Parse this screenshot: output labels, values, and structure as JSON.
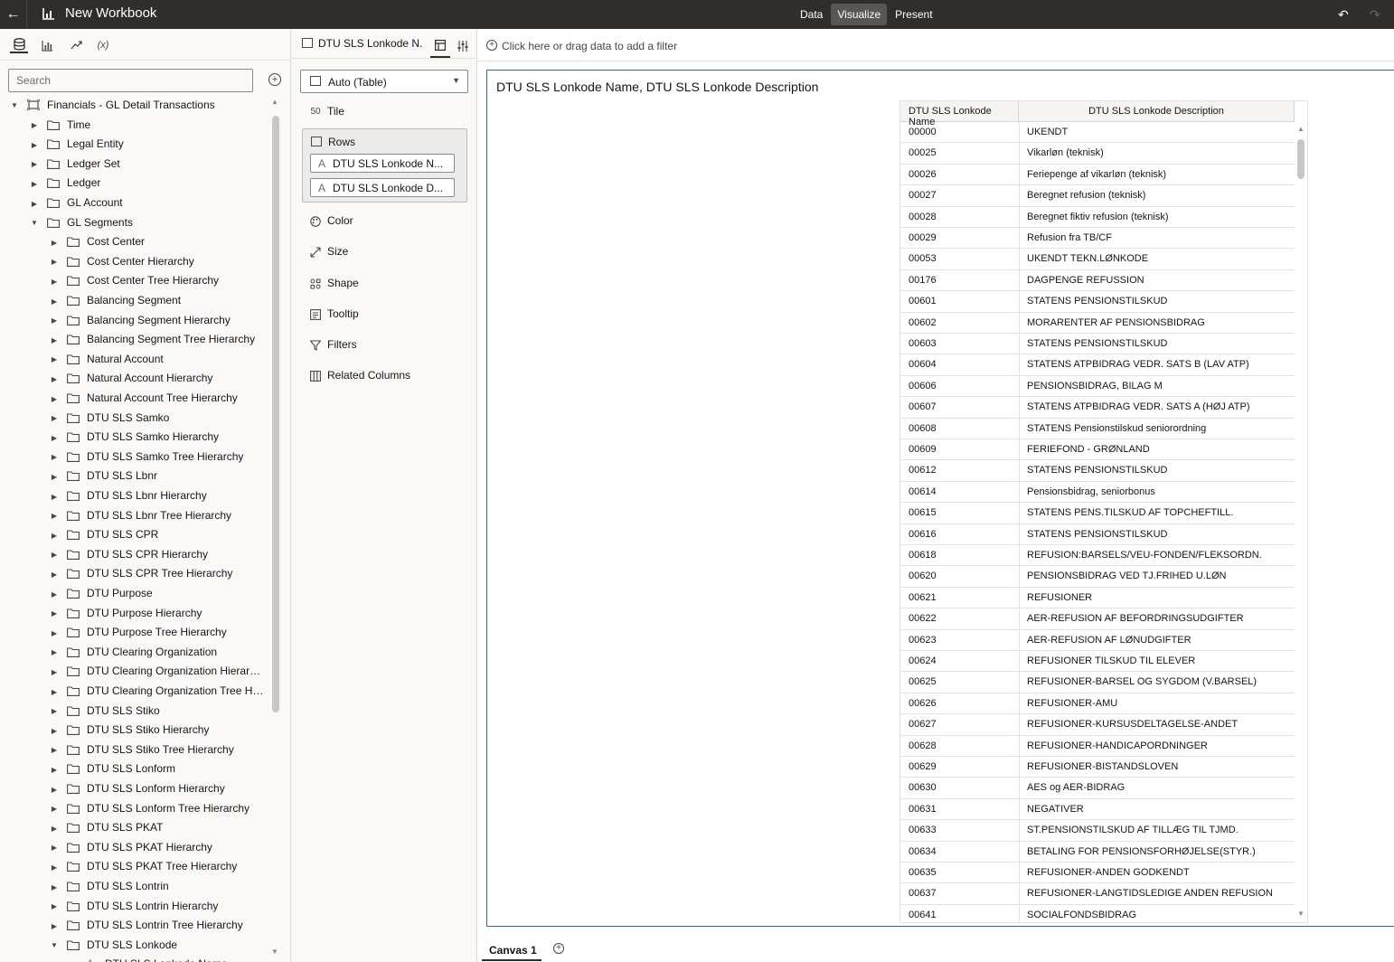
{
  "header": {
    "title": "New Workbook",
    "modes": [
      "Data",
      "Visualize",
      "Present"
    ],
    "active_mode": "Visualize"
  },
  "data_panel": {
    "search_placeholder": "Search",
    "subject_area": "Financials - GL Detail Transactions",
    "folders": [
      "Time",
      "Legal Entity",
      "Ledger Set",
      "Ledger",
      "GL Account",
      "GL Segments"
    ],
    "segments": [
      "Cost Center",
      "Cost Center Hierarchy",
      "Cost Center Tree Hierarchy",
      "Balancing Segment",
      "Balancing Segment Hierarchy",
      "Balancing Segment Tree Hierarchy",
      "Natural Account",
      "Natural Account Hierarchy",
      "Natural Account Tree Hierarchy",
      "DTU SLS Samko",
      "DTU SLS Samko Hierarchy",
      "DTU SLS Samko Tree Hierarchy",
      "DTU SLS Lbnr",
      "DTU SLS Lbnr Hierarchy",
      "DTU SLS Lbnr Tree Hierarchy",
      "DTU SLS CPR",
      "DTU SLS CPR Hierarchy",
      "DTU SLS CPR Tree Hierarchy",
      "DTU Purpose",
      "DTU Purpose Hierarchy",
      "DTU Purpose Tree Hierarchy",
      "DTU Clearing Organization",
      "DTU Clearing Organization Hierarchy",
      "DTU Clearing Organization Tree Hiera...",
      "DTU SLS Stiko",
      "DTU SLS Stiko Hierarchy",
      "DTU SLS Stiko Tree Hierarchy",
      "DTU SLS Lonform",
      "DTU SLS Lonform Hierarchy",
      "DTU SLS Lonform Tree Hierarchy",
      "DTU SLS PKAT",
      "DTU SLS PKAT Hierarchy",
      "DTU SLS PKAT Tree Hierarchy",
      "DTU SLS Lontrin",
      "DTU SLS Lontrin Hierarchy",
      "DTU SLS Lontrin Tree Hierarchy",
      "DTU SLS Lonkode"
    ],
    "expanded_child": "DTU SLS Lonkode Name"
  },
  "grammar_panel": {
    "viz_name": "DTU SLS Lonkode N...",
    "viz_type": "Auto (Table)",
    "tile_label": "Tile",
    "rows_label": "Rows",
    "row_pills": [
      "DTU SLS Lonkode N...",
      "DTU SLS Lonkode D..."
    ],
    "sections": [
      "Color",
      "Size",
      "Shape",
      "Tooltip",
      "Filters",
      "Related Columns"
    ]
  },
  "filter_bar": {
    "placeholder": "Click here or drag data to add a filter"
  },
  "viz": {
    "title": "DTU SLS Lonkode Name, DTU SLS Lonkode Description",
    "columns": [
      "DTU SLS Lonkode Name",
      "DTU SLS Lonkode Description"
    ],
    "rows": [
      [
        "00000",
        "UKENDT"
      ],
      [
        "00025",
        "Vikarløn (teknisk)"
      ],
      [
        "00026",
        "Feriepenge af vikarløn (teknisk)"
      ],
      [
        "00027",
        "Beregnet refusion (teknisk)"
      ],
      [
        "00028",
        "Beregnet fiktiv refusion (teknisk)"
      ],
      [
        "00029",
        "Refusion fra TB/CF"
      ],
      [
        "00053",
        "UKENDT TEKN.LØNKODE"
      ],
      [
        "00176",
        "DAGPENGE REFUSSION"
      ],
      [
        "00601",
        "STATENS PENSIONSTILSKUD"
      ],
      [
        "00602",
        "MORARENTER AF PENSIONSBIDRAG"
      ],
      [
        "00603",
        "STATENS PENSIONSTILSKUD"
      ],
      [
        "00604",
        "STATENS ATPBIDRAG VEDR. SATS B (LAV ATP)"
      ],
      [
        "00606",
        "PENSIONSBIDRAG, BILAG M"
      ],
      [
        "00607",
        "STATENS ATPBIDRAG VEDR. SATS A (HØJ ATP)"
      ],
      [
        "00608",
        "STATENS Pensionstilskud seniorordning"
      ],
      [
        "00609",
        "FERIEFOND - GRØNLAND"
      ],
      [
        "00612",
        "STATENS PENSIONSTILSKUD"
      ],
      [
        "00614",
        "Pensionsbidrag, seniorbonus"
      ],
      [
        "00615",
        "STATENS PENS.TILSKUD AF TOPCHEFTILL."
      ],
      [
        "00616",
        "STATENS PENSIONSTILSKUD"
      ],
      [
        "00618",
        "REFUSION:BARSELS/VEU-FONDEN/FLEKSORDN."
      ],
      [
        "00620",
        "PENSIONSBIDRAG VED TJ.FRIHED U.LØN"
      ],
      [
        "00621",
        "REFUSIONER"
      ],
      [
        "00622",
        "AER-REFUSION AF BEFORDRINGSUDGIFTER"
      ],
      [
        "00623",
        "AER-REFUSION AF LØNUDGIFTER"
      ],
      [
        "00624",
        "REFUSIONER TILSKUD TIL ELEVER"
      ],
      [
        "00625",
        "REFUSIONER-BARSEL OG SYGDOM (V.BARSEL)"
      ],
      [
        "00626",
        "REFUSIONER-AMU"
      ],
      [
        "00627",
        "REFUSIONER-KURSUSDELTAGELSE-ANDET"
      ],
      [
        "00628",
        "REFUSIONER-HANDICAPORDNINGER"
      ],
      [
        "00629",
        "REFUSIONER-BISTANDSLOVEN"
      ],
      [
        "00630",
        "AES og AER-BIDRAG"
      ],
      [
        "00631",
        "NEGATIVER"
      ],
      [
        "00633",
        "ST.PENSIONSTILSKUD AF TILLÆG TIL TJMD."
      ],
      [
        "00634",
        "BETALING FOR PENSIONSFORHØJELSE(STYR.)"
      ],
      [
        "00635",
        "REFUSIONER-ANDEN GODKENDT"
      ],
      [
        "00637",
        "REFUSIONER-LANGTIDSLEDIGE ANDEN REFUSION"
      ],
      [
        "00641",
        "SOCIALFONDSBIDRAG"
      ]
    ]
  },
  "canvas_tabs": [
    "Canvas 1"
  ],
  "colors": {
    "topbar": "#312d2a",
    "selection_border": "#2f6a8f"
  }
}
